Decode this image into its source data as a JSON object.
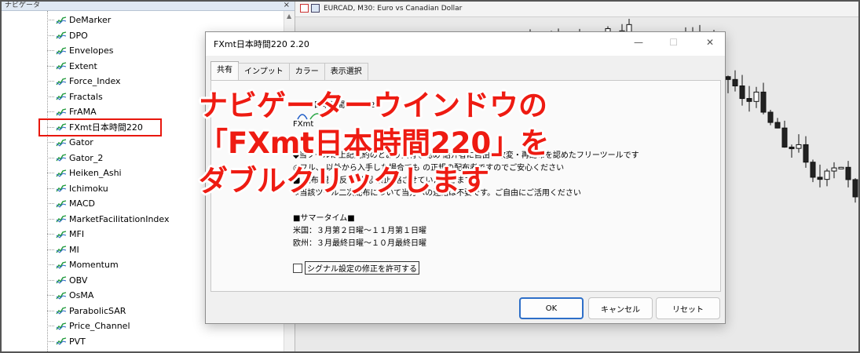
{
  "navigator": {
    "title": "ナビゲータ",
    "close_glyph": "×",
    "items": [
      {
        "label": "DeMarker"
      },
      {
        "label": "DPO"
      },
      {
        "label": "Envelopes"
      },
      {
        "label": "Extent"
      },
      {
        "label": "Force_Index"
      },
      {
        "label": "Fractals"
      },
      {
        "label": "FrAMA"
      },
      {
        "label": "FXmt日本時間220",
        "highlighted": true
      },
      {
        "label": "Gator"
      },
      {
        "label": "Gator_2"
      },
      {
        "label": "Heiken_Ashi"
      },
      {
        "label": "Ichimoku"
      },
      {
        "label": "MACD"
      },
      {
        "label": "MarketFacilitationIndex"
      },
      {
        "label": "MFI"
      },
      {
        "label": "MI"
      },
      {
        "label": "Momentum"
      },
      {
        "label": "OBV"
      },
      {
        "label": "OsMA"
      },
      {
        "label": "ParabolicSAR"
      },
      {
        "label": "Price_Channel"
      },
      {
        "label": "PVT"
      }
    ],
    "highlight_color": "#e8170d"
  },
  "chart": {
    "title": "EURCAD, M30:  Euro vs Canadian Dollar",
    "background": "#e9e9e9"
  },
  "dialog": {
    "title": "FXmt日本時間220 2.20",
    "controls": {
      "minimize": "—",
      "maximize": "☐",
      "close": "✕"
    },
    "tabs": [
      {
        "label": "共有",
        "active": true
      },
      {
        "label": "インプット"
      },
      {
        "label": "カラー"
      },
      {
        "label": "表示選択"
      }
    ],
    "content_lines": [
      "FXmt日本時間220 2.20",
      "FXmt",
      "◆当ツールは上記規約のとおり共有を認め 紹介者に自由に改変・再配布を認めたフリーツールです",
      "◎フル、 以外から入手した場合でも の正規の配布者ですのでご安心ください",
      "■ 配布 規 違反 な確認 禁止 絡させていただきます",
      "※当該ツール二次配布について当方への連絡は不要です。ご自由にご活用ください",
      "■サマータイム■",
      "米国：３月第２日曜～１１月第１日曜",
      "欧州：３月最終日曜～１０月最終日曜"
    ],
    "checkbox_label": "シグナル設定の修正を許可する",
    "checkbox_checked": false,
    "buttons": {
      "ok": "OK",
      "cancel": "キャンセル",
      "reset": "リセット"
    }
  },
  "annotation": {
    "lines": [
      "ナビゲーターウインドウの",
      "「FXmt日本時間220」を",
      "ダブルクリックします"
    ],
    "color": "#ee1b12"
  }
}
